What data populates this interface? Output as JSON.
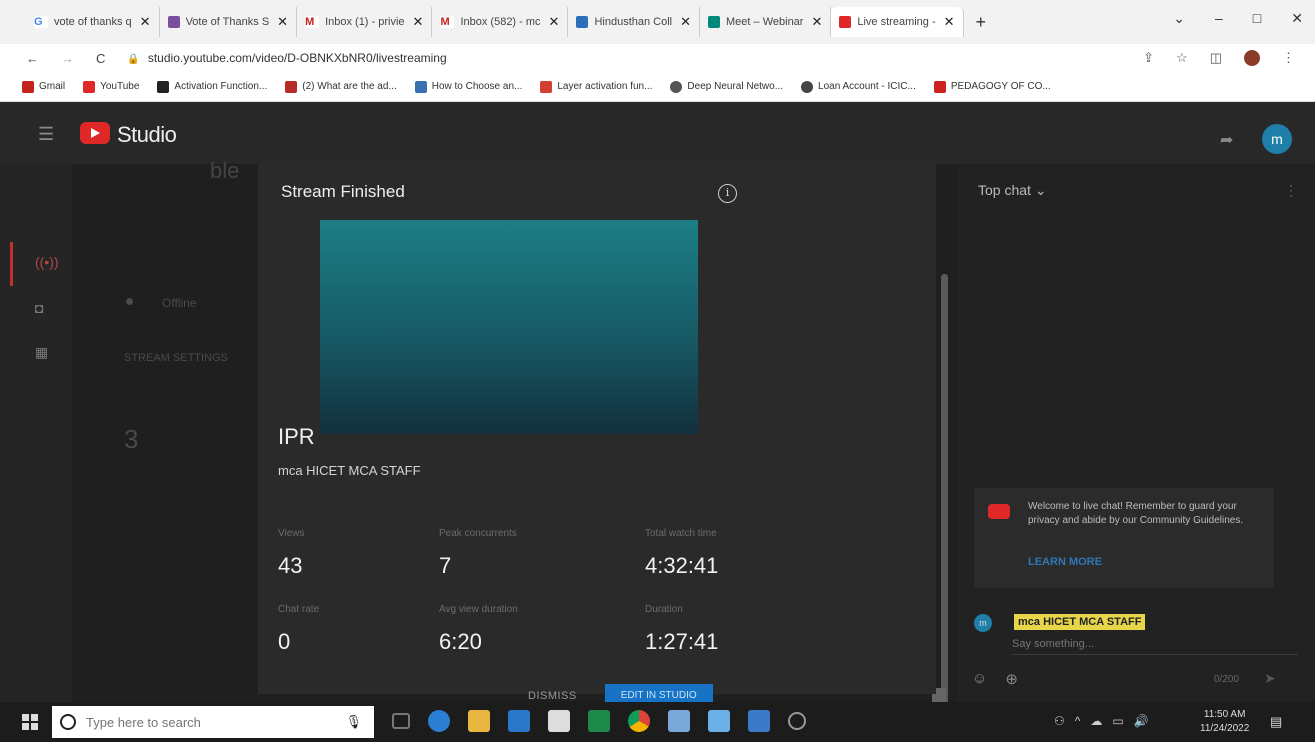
{
  "browser": {
    "tabs": [
      {
        "label": "vote of thanks q",
        "fav_color": "#4285f4",
        "fav_text": "G"
      },
      {
        "label": "Vote of Thanks S",
        "fav_color": "#7b4ea0",
        "fav_text": ""
      },
      {
        "label": "Inbox (1) - privie",
        "fav_color": "#c5221f",
        "fav_text": "M"
      },
      {
        "label": "Inbox (582) - mc",
        "fav_color": "#c5221f",
        "fav_text": "M"
      },
      {
        "label": "Hindusthan Coll",
        "fav_color": "#2a6fb7",
        "fav_text": ""
      },
      {
        "label": "Meet – Webinar",
        "fav_color": "#00897b",
        "fav_text": ""
      },
      {
        "label": "Live streaming -",
        "fav_color": "#e02828",
        "fav_text": ""
      }
    ],
    "new_tab": "+",
    "window_controls": [
      "⌄",
      "–",
      "□",
      "✕"
    ],
    "url": "studio.youtube.com/video/D-OBNKXbNR0/livestreaming",
    "bookmarks": [
      {
        "label": "Gmail",
        "color": "#c5221f"
      },
      {
        "label": "YouTube",
        "color": "#e02828"
      },
      {
        "label": "Activation Function...",
        "color": "#222222"
      },
      {
        "label": "(2) What are the ad...",
        "color": "#b92b27"
      },
      {
        "label": "How to Choose an...",
        "color": "#3a6fb0"
      },
      {
        "label": "Layer activation fun...",
        "color": "#d23f31"
      },
      {
        "label": "Deep Neural Netwo...",
        "color": "#555555"
      },
      {
        "label": "Loan Account - ICIC...",
        "color": "#444444"
      },
      {
        "label": "PEDAGOGY OF CO...",
        "color": "#cc2222"
      }
    ]
  },
  "studio": {
    "logo_label": "Studio",
    "avatar_letter": "m"
  },
  "background": {
    "title_fragment": "ble",
    "status": "Offline",
    "settings_label": "STREAM SETTINGS",
    "number": "3"
  },
  "modal": {
    "title": "Stream Finished",
    "info_icon": "i",
    "video_title": "IPR",
    "channel": "mca HICET MCA STAFF",
    "stats": [
      {
        "label": "Views",
        "value": "43"
      },
      {
        "label": "Peak concurrents",
        "value": "7"
      },
      {
        "label": "Total watch time",
        "value": "4:32:41"
      },
      {
        "label": "Chat rate",
        "value": "0"
      },
      {
        "label": "Avg view duration",
        "value": "6:20"
      },
      {
        "label": "Duration",
        "value": "1:27:41"
      }
    ],
    "dismiss": "DISMISS",
    "edit": "EDIT IN STUDIO"
  },
  "chat": {
    "header": "Top chat",
    "welcome": "Welcome to live chat! Remember to guard your privacy and abide by our Community Guidelines.",
    "learn_more": "LEARN MORE",
    "user": "mca HICET MCA STAFF",
    "placeholder": "Say something...",
    "count": "0/200"
  },
  "taskbar": {
    "search_placeholder": "Type here to search",
    "time": "11:50 AM",
    "date": "11/24/2022"
  }
}
